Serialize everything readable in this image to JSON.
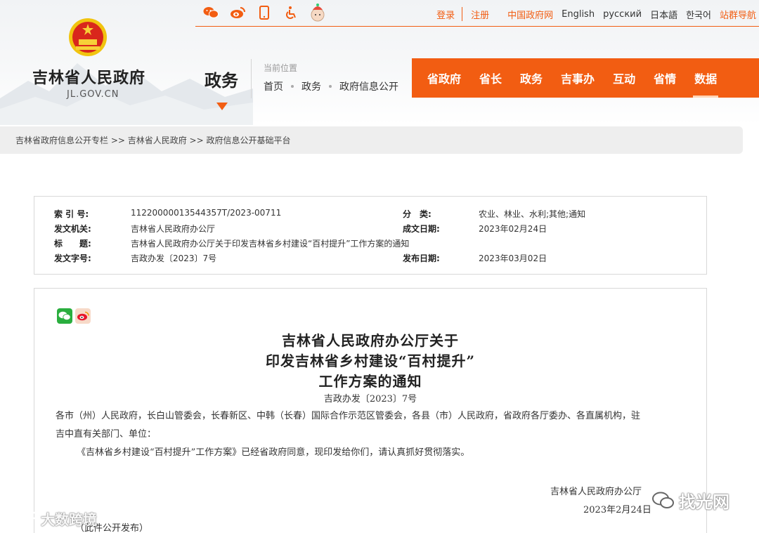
{
  "site": {
    "name": "吉林省人民政府",
    "domain": "JL.GOV.CN"
  },
  "section": {
    "title": "政务"
  },
  "location": {
    "label": "当前位置",
    "crumbs": [
      "首页",
      "政务",
      "政府信息公开"
    ]
  },
  "share_icons": [
    "wechat-icon",
    "weibo-icon",
    "mobile-icon",
    "accessibility-icon",
    "mascot-icon"
  ],
  "top_links": {
    "login": "登录",
    "register": "注册",
    "china_gov": "中国政府网",
    "english": "English",
    "russian": "русский",
    "japanese": "日本語",
    "korean": "한국어",
    "sitemap": "站群导航"
  },
  "nav": {
    "items": [
      "省政府",
      "省长",
      "政务",
      "吉事办",
      "互动",
      "省情",
      "数据"
    ],
    "active": "数据"
  },
  "breadcrumb_bar": "吉林省政府信息公开专栏 >> 吉林省人民政府 >> 政府信息公开基础平台",
  "meta": {
    "index_label": "索 引 号:",
    "index_value": "11220000013544357T/2023-00711",
    "category_label": "分　类:",
    "category_value": "农业、林业、水利;其他;通知",
    "issuer_label": "发文机关:",
    "issuer_value": "吉林省人民政府办公厅",
    "written_label": "成文日期:",
    "written_value": "2023年02月24日",
    "title_label": "标　　题:",
    "title_value": "吉林省人民政府办公厅关于印发吉林省乡村建设“百村提升”工作方案的通知",
    "docno_label": "发文字号:",
    "docno_value": "吉政办发〔2023〕7号",
    "publish_label": "发布日期:",
    "publish_value": "2023年03月02日"
  },
  "document": {
    "title_lines": [
      "吉林省人民政府办公厅关于",
      "印发吉林省乡村建设“百村提升”",
      "工作方案的通知"
    ],
    "doc_number": "吉政办发〔2023〕7号",
    "addressees_line1": "各市（州）人民政府，长白山管委会，长春新区、中韩（长春）国际合作示范区管委会，各县（市）人民政府，省政府各厅委办、各直属机构，驻",
    "addressees_line2": "吉中直有关部门、单位：",
    "body": "《吉林省乡村建设“百村提升”工作方案》已经省政府同意，现印发给你们，请认真抓好贯彻落实。",
    "signature": "吉林省人民政府办公厅",
    "date": "2023年2月24日",
    "note": "（此件公开发布）"
  },
  "watermarks": {
    "left": "大数跨境",
    "right": "找光网"
  },
  "colors": {
    "accent": "#f25d12",
    "wechat": "#2aae3e",
    "weibo": "#e6162d"
  }
}
